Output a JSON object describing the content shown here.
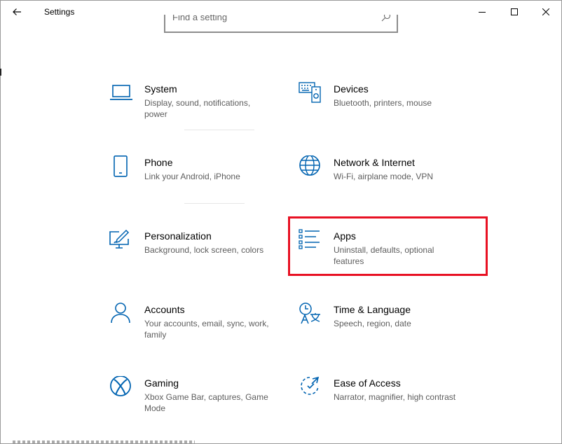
{
  "window": {
    "title": "Settings"
  },
  "search": {
    "placeholder": "Find a setting"
  },
  "categories": [
    {
      "name": "System",
      "desc": "Display, sound, notifications, power",
      "icon": "laptop-icon"
    },
    {
      "name": "Devices",
      "desc": "Bluetooth, printers, mouse",
      "icon": "keyboard-speaker-icon"
    },
    {
      "name": "Phone",
      "desc": "Link your Android, iPhone",
      "icon": "phone-icon"
    },
    {
      "name": "Network & Internet",
      "desc": "Wi-Fi, airplane mode, VPN",
      "icon": "globe-icon"
    },
    {
      "name": "Personalization",
      "desc": "Background, lock screen, colors",
      "icon": "paint-monitor-icon"
    },
    {
      "name": "Apps",
      "desc": "Uninstall, defaults, optional features",
      "icon": "apps-list-icon"
    },
    {
      "name": "Accounts",
      "desc": "Your accounts, email, sync, work, family",
      "icon": "person-icon"
    },
    {
      "name": "Time & Language",
      "desc": "Speech, region, date",
      "icon": "time-language-icon"
    },
    {
      "name": "Gaming",
      "desc": "Xbox Game Bar, captures, Game Mode",
      "icon": "xbox-icon"
    },
    {
      "name": "Ease of Access",
      "desc": "Narrator, magnifier, high contrast",
      "icon": "ease-of-access-icon"
    }
  ],
  "colors": {
    "accent": "#0063b1",
    "highlight": "#e81123"
  }
}
